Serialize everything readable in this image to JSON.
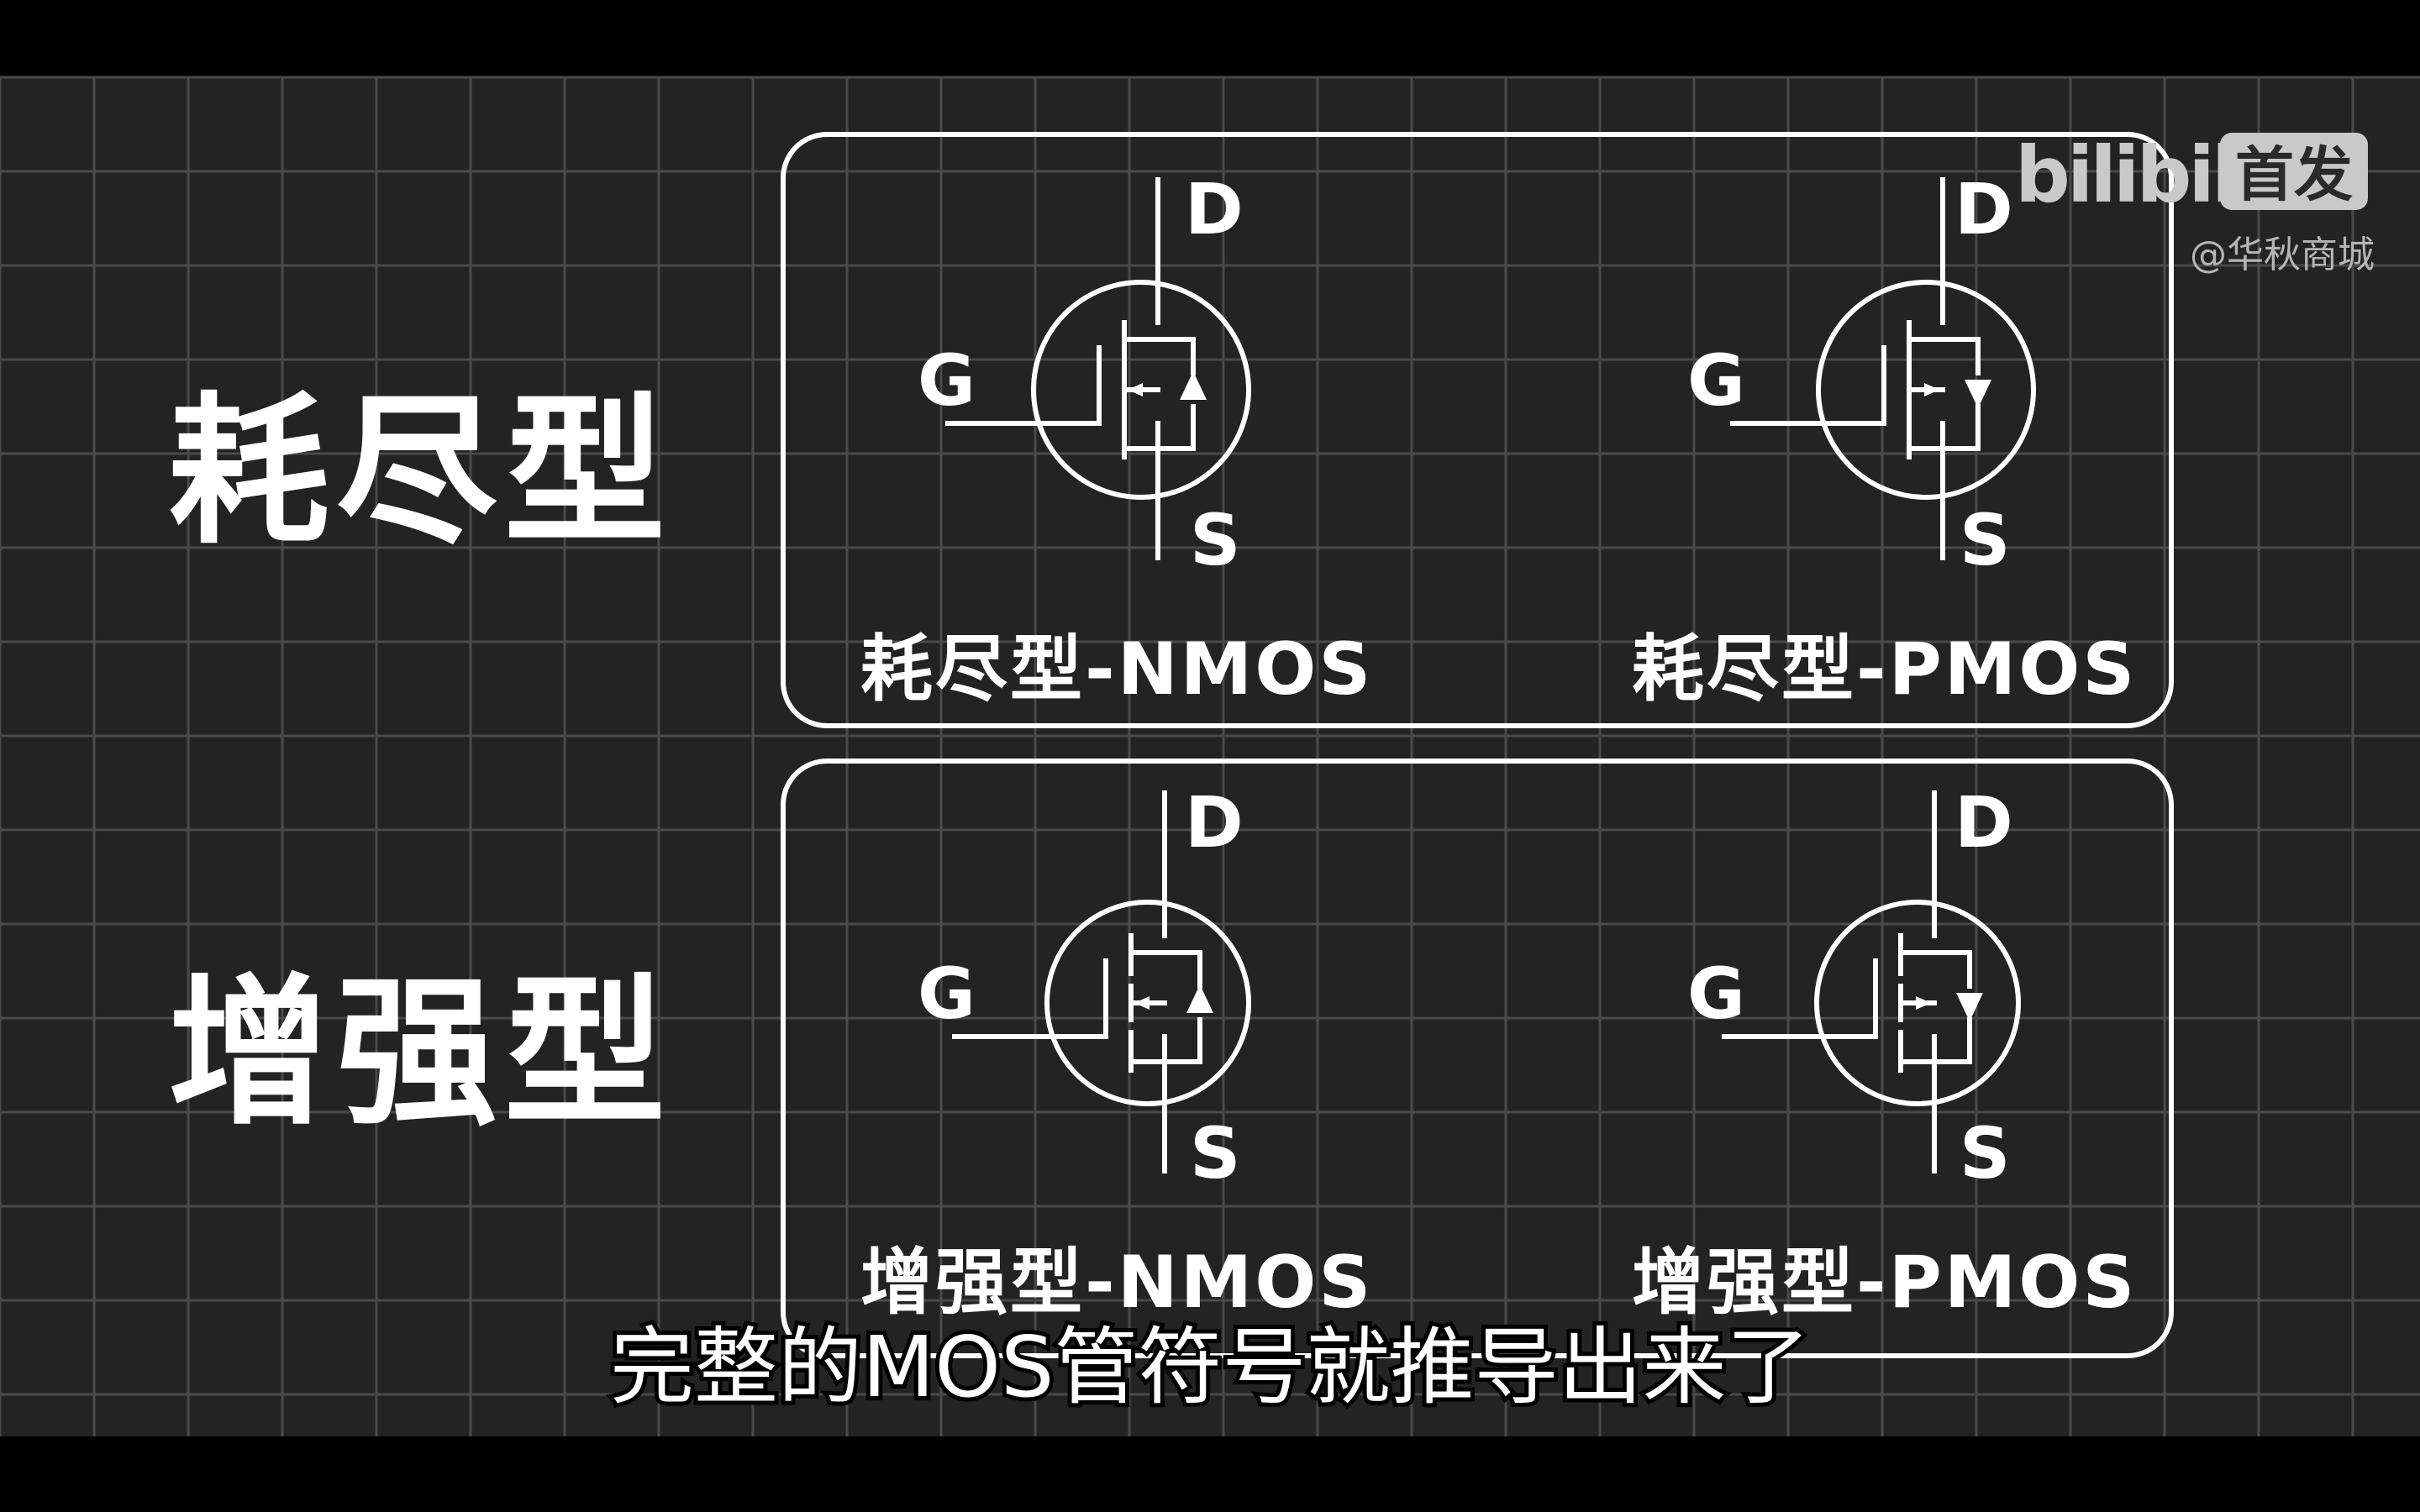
{
  "rows": [
    {
      "title": "耗尽型",
      "symbols": [
        {
          "label": "耗尽型-NMOS",
          "type": "N",
          "channel": "depletion"
        },
        {
          "label": "耗尽型-PMOS",
          "type": "P",
          "channel": "depletion"
        }
      ]
    },
    {
      "title": "增强型",
      "symbols": [
        {
          "label": "增强型-NMOS",
          "type": "N",
          "channel": "enhancement"
        },
        {
          "label": "增强型-PMOS",
          "type": "P",
          "channel": "enhancement"
        }
      ]
    }
  ],
  "terminals": {
    "drain": "D",
    "gate": "G",
    "source": "S"
  },
  "subtitle": "完整的MOS管符号就推导出来了",
  "watermark": {
    "logo": "bilibili",
    "badge": "首发",
    "user": "@华秋商城"
  },
  "colors": {
    "background": "#232323",
    "grid": "#4a4a4a",
    "foreground": "#ffffff",
    "letterbox": "#000000"
  }
}
